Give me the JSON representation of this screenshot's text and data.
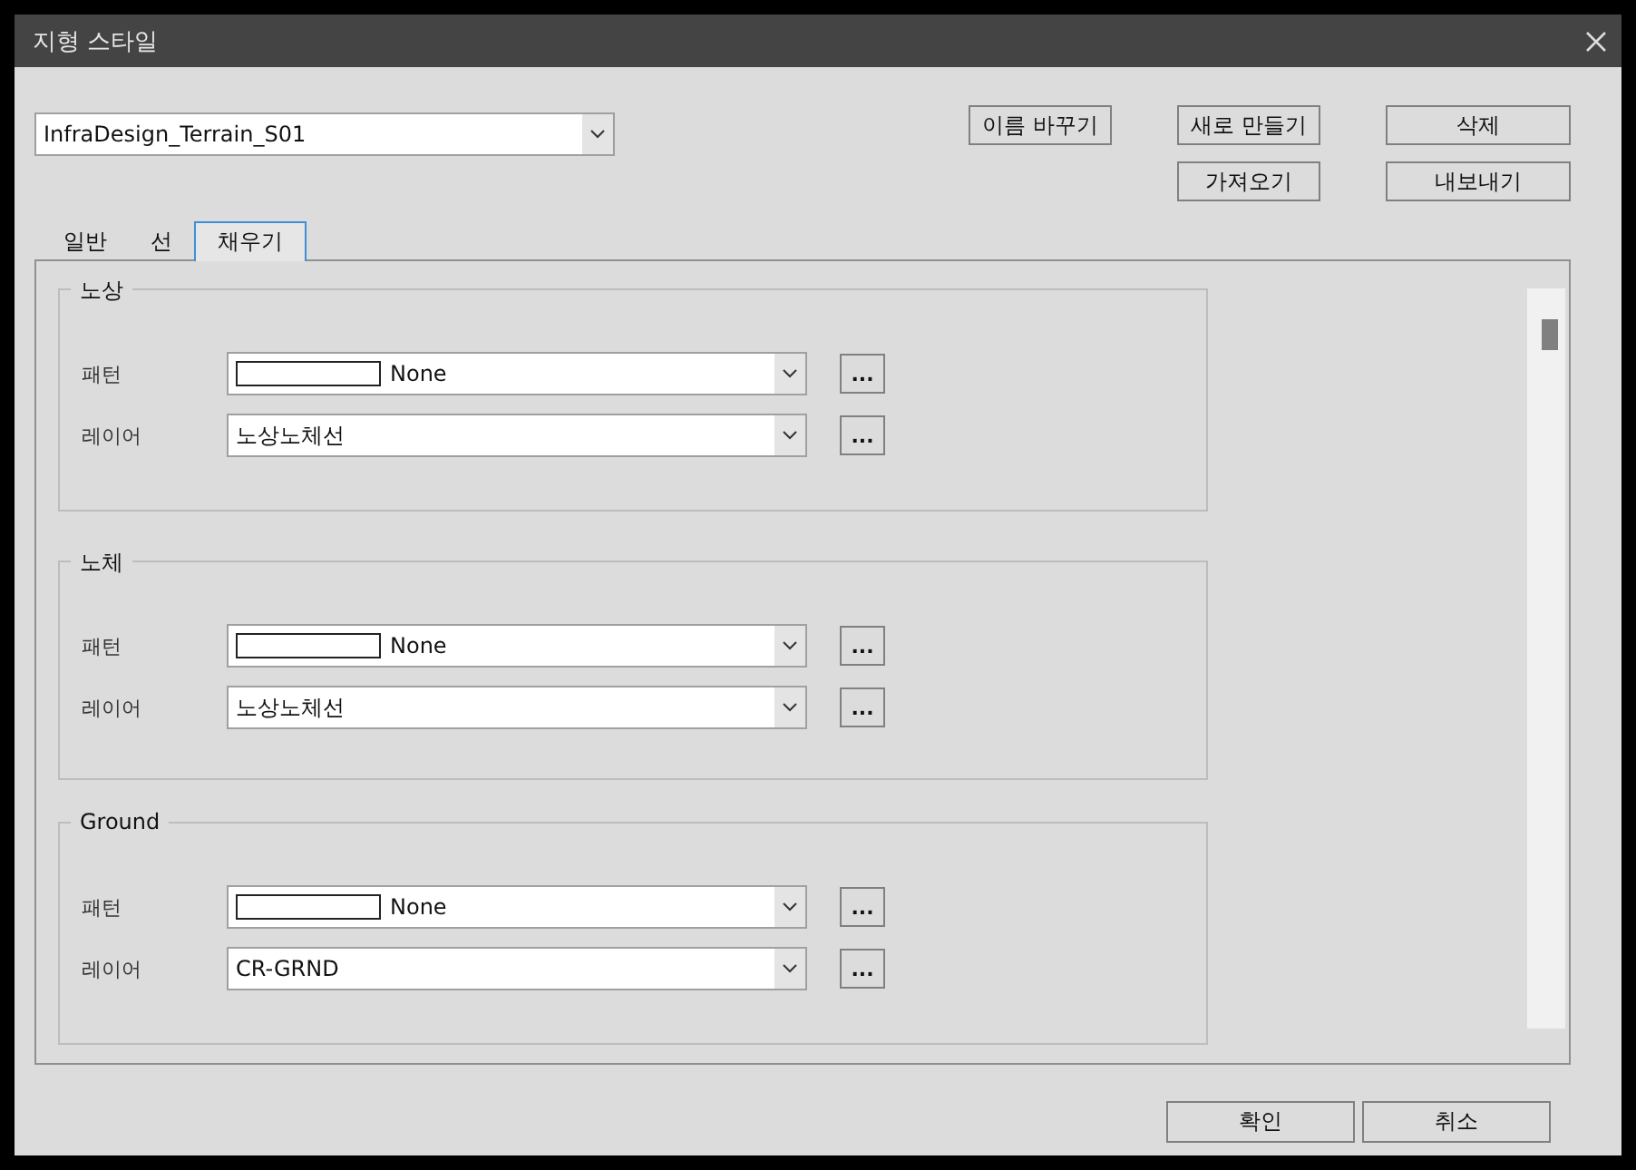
{
  "window": {
    "title": "지형 스타일"
  },
  "style_select": {
    "value": "InfraDesign_Terrain_S01"
  },
  "action_buttons": [
    [
      "이름 바꾸기",
      "새로 만들기",
      "삭제"
    ],
    [
      "가져오기",
      "내보내기"
    ]
  ],
  "tabs": [
    {
      "label": "일반",
      "selected": false
    },
    {
      "label": "선",
      "selected": false
    },
    {
      "label": "채우기",
      "selected": true
    }
  ],
  "groups": [
    {
      "title": "노상",
      "rows": [
        {
          "kind": "pattern",
          "label": "패턴",
          "value": "None",
          "button": "..."
        },
        {
          "kind": "layer",
          "label": "레이어",
          "value": "노상노체선",
          "button": "..."
        }
      ]
    },
    {
      "title": "노체",
      "rows": [
        {
          "kind": "pattern",
          "label": "패턴",
          "value": "None",
          "button": "..."
        },
        {
          "kind": "layer",
          "label": "레이어",
          "value": "노상노체선",
          "button": "..."
        }
      ]
    },
    {
      "title": "Ground",
      "rows": [
        {
          "kind": "pattern",
          "label": "패턴",
          "value": "None",
          "button": "..."
        },
        {
          "kind": "layer",
          "label": "레이어",
          "value": "CR-GRND",
          "button": "..."
        }
      ]
    }
  ],
  "footer_buttons": [
    "확인",
    "취소"
  ]
}
